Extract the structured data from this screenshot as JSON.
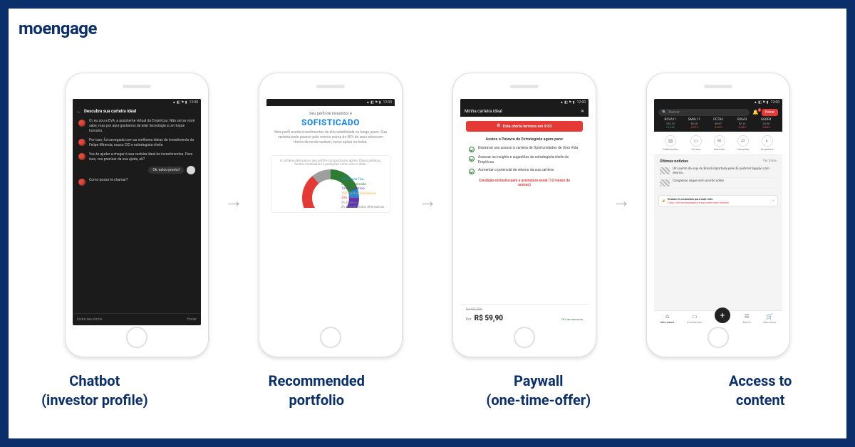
{
  "brand": "moengage",
  "captions": [
    "Chatbot\n(investor profile)",
    "Recommended\nportfolio",
    "Paywall\n(one-time-offer)",
    "Access to\ncontent"
  ],
  "statusbar_time": "12:00",
  "screen1": {
    "title": "Descubra sua carteira ideal",
    "msg1": "Oi, eu sou a EVA, a assistente virtual da Empiricus. Não sei se você sabe, mas por aqui gostamos de aliar tecnologia a um toque humano.",
    "msg2": "Por isso, fui carregada com as melhores ideias de investimento do Felipe Miranda, nosso CIO e estrategista-chefe.",
    "msg3": "Vou te ajudar a chegar à sua carteira ideal de investimentos. Para isso, vou precisar da sua ajuda, ok?",
    "reply": "Ok, estou pronto!",
    "msg4": "Como posso te chamar?",
    "input_placeholder": "Insira seu nome",
    "send": "Enviar"
  },
  "screen2": {
    "pre": "Seu perfil de investidor é",
    "profile": "SOFISTICADO",
    "desc": "Este perfil aceita investimentos de alta volatilidade no longo prazo. Sua carteira pode possuir pelo menos acima de 40% de seus ativos em títulos de renda variável, como ações na bolsa.",
    "card_head": "A carteira ideal para o seu perfil é composta por ações, títulos públicos, fundos imobiliários e proteções como ouro e dólar.",
    "legend": [
      {
        "pct": "20%",
        "label": "Renda Fixa"
      },
      {
        "pct": "5%",
        "label": "Multimercado"
      },
      {
        "pct": "10%",
        "label": "Previdência"
      },
      {
        "pct": "15%",
        "label": "Fundos Imobiliários"
      },
      {
        "pct": "30%",
        "label": "Ações"
      },
      {
        "pct": "5%",
        "label": "Exterior"
      },
      {
        "pct": "2%",
        "label": "Investimentos Alternativos"
      }
    ]
  },
  "screen3": {
    "title": "Minha carteira ideal",
    "banner": "Esta oferta termina em 9:53",
    "sub": "Assine o Palavra do Estrategista agora para:",
    "items": [
      "Destravar seu acesso à carteira de Oportunidades de Uma Vida",
      "Acessar os insights e sugestões do estrategista-chefe da Empiricus",
      "Aumentar o potencial de retorno da sua carteira"
    ],
    "exclusive": "Condição exclusiva para a assinatura anual (12 meses de acesso)",
    "old": "De R$ 206",
    "por": "Por",
    "price": "R$ 59,90",
    "save": "70% de desconto"
  },
  "screen4": {
    "search_placeholder": "Buscar",
    "bell_count": "2",
    "enter": "Entrar",
    "tickers": [
      {
        "n": "BOVA11",
        "v": "105,73",
        "c": "+2,74%",
        "dir": "up"
      },
      {
        "n": "SMAL11",
        "v": "50,28",
        "c": "-0,27%",
        "dir": "dn"
      },
      {
        "n": "PETR4",
        "v": "30,97",
        "c": "-3,00%",
        "dir": "dn"
      },
      {
        "n": "B3SA3",
        "v": "52,14",
        "c": "-0,05%",
        "dir": "dn"
      },
      {
        "n": "GGBR4",
        "v": "20,90",
        "c": "-2,86%",
        "dir": "dn"
      }
    ],
    "rail": [
      "Publicações",
      "Cursos",
      "Notícias",
      "Cotações",
      "Empiricus"
    ],
    "news_h": "Últimas notícias",
    "news_all": "Ver todas",
    "news": [
      "Um quinto da soja do Brasil importada pela UE pode ter ligação com desma…",
      "Congresso segue sem acordo sobre"
    ],
    "toast": "Restam 5 conteúdos para este mês",
    "toast_sub": "Click, crie conta gratuita e aproveite sem limites!",
    "tabs": [
      "Meu painel",
      "Assinaturas",
      "",
      "Minha",
      "Mercados"
    ]
  }
}
